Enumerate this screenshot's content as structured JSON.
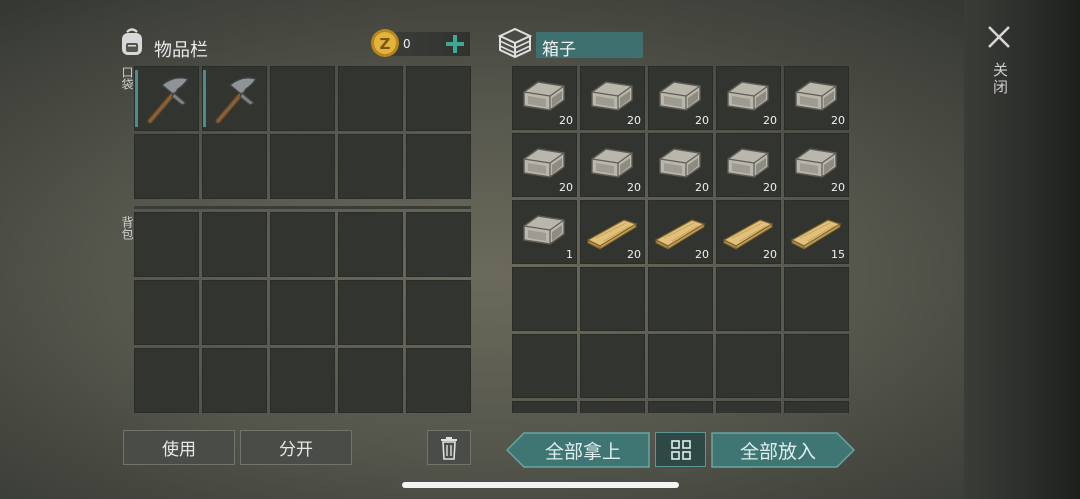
{
  "inventory": {
    "title": "物品栏",
    "pocket_label": "口袋",
    "backpack_label": "背包",
    "coin_amount": "0",
    "pocket_slots": [
      {
        "item": "pickaxe",
        "qty": ""
      },
      {
        "item": "pickaxe",
        "qty": ""
      },
      {
        "item": "",
        "qty": ""
      },
      {
        "item": "",
        "qty": ""
      },
      {
        "item": "",
        "qty": ""
      },
      {
        "item": "",
        "qty": ""
      },
      {
        "item": "",
        "qty": ""
      },
      {
        "item": "",
        "qty": ""
      },
      {
        "item": "",
        "qty": ""
      },
      {
        "item": "",
        "qty": ""
      }
    ],
    "backpack_slots": [
      {
        "item": "",
        "qty": ""
      },
      {
        "item": "",
        "qty": ""
      },
      {
        "item": "",
        "qty": ""
      },
      {
        "item": "",
        "qty": ""
      },
      {
        "item": "",
        "qty": ""
      },
      {
        "item": "",
        "qty": ""
      },
      {
        "item": "",
        "qty": ""
      },
      {
        "item": "",
        "qty": ""
      },
      {
        "item": "",
        "qty": ""
      },
      {
        "item": "",
        "qty": ""
      },
      {
        "item": "",
        "qty": ""
      },
      {
        "item": "",
        "qty": ""
      },
      {
        "item": "",
        "qty": ""
      },
      {
        "item": "",
        "qty": ""
      },
      {
        "item": "",
        "qty": ""
      }
    ],
    "use_label": "使用",
    "split_label": "分开"
  },
  "container": {
    "title": "箱子",
    "slots": [
      {
        "item": "stone",
        "qty": "20"
      },
      {
        "item": "stone",
        "qty": "20"
      },
      {
        "item": "stone",
        "qty": "20"
      },
      {
        "item": "stone",
        "qty": "20"
      },
      {
        "item": "stone",
        "qty": "20"
      },
      {
        "item": "stone",
        "qty": "20"
      },
      {
        "item": "stone",
        "qty": "20"
      },
      {
        "item": "stone",
        "qty": "20"
      },
      {
        "item": "stone",
        "qty": "20"
      },
      {
        "item": "stone",
        "qty": "20"
      },
      {
        "item": "stone",
        "qty": "1"
      },
      {
        "item": "plank",
        "qty": "20"
      },
      {
        "item": "plank",
        "qty": "20"
      },
      {
        "item": "plank",
        "qty": "20"
      },
      {
        "item": "plank",
        "qty": "15"
      },
      {
        "item": "",
        "qty": ""
      },
      {
        "item": "",
        "qty": ""
      },
      {
        "item": "",
        "qty": ""
      },
      {
        "item": "",
        "qty": ""
      },
      {
        "item": "",
        "qty": ""
      },
      {
        "item": "",
        "qty": ""
      },
      {
        "item": "",
        "qty": ""
      },
      {
        "item": "",
        "qty": ""
      },
      {
        "item": "",
        "qty": ""
      },
      {
        "item": "",
        "qty": ""
      },
      {
        "item": "",
        "qty": ""
      },
      {
        "item": "",
        "qty": ""
      },
      {
        "item": "",
        "qty": ""
      },
      {
        "item": "",
        "qty": ""
      },
      {
        "item": "",
        "qty": ""
      }
    ],
    "take_all_label": "全部拿上",
    "put_all_label": "全部放入"
  },
  "close_label": "关闭",
  "icons": {
    "backpack": "backpack-icon",
    "coin": "coin-icon",
    "add": "plus-icon",
    "chest": "chest-icon",
    "close": "close-icon",
    "trash": "trash-icon",
    "sort": "sort-icon"
  },
  "colors": {
    "accent_teal": "#4d8c8c",
    "coin_gold": "#d8a732"
  }
}
